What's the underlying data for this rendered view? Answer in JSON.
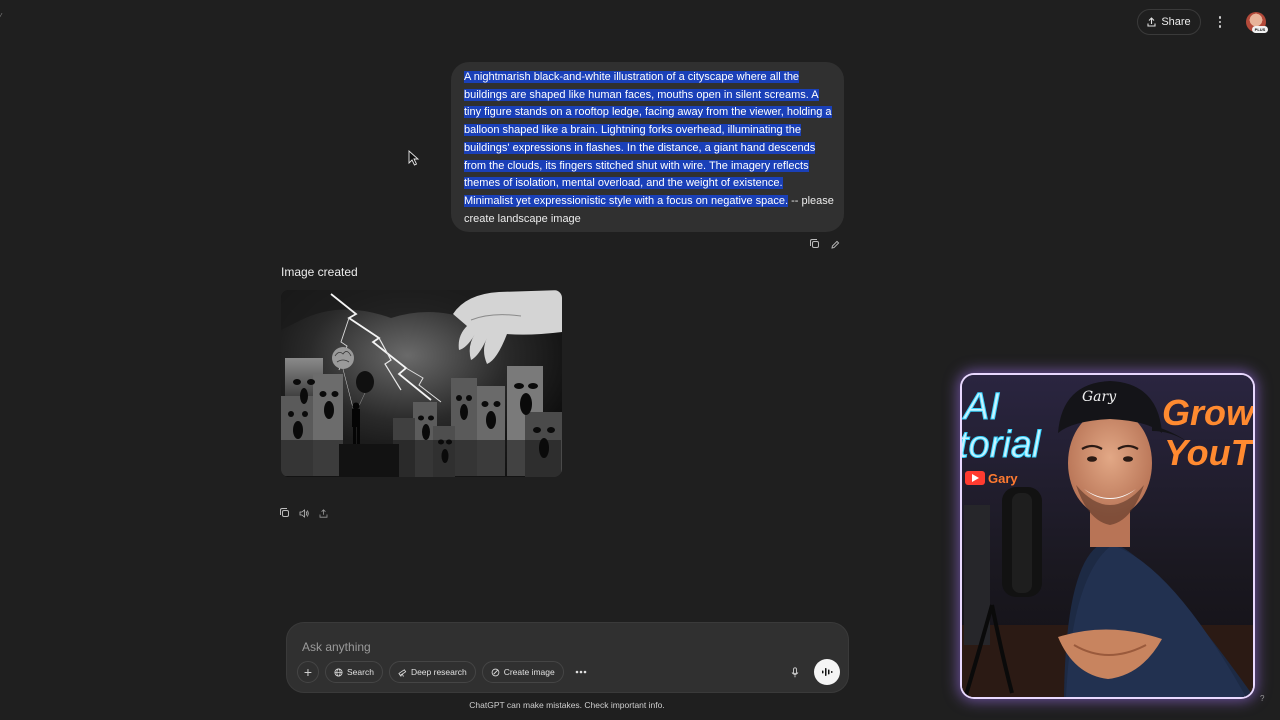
{
  "topbar": {
    "share_label": "Share",
    "avatar_badge": "PLUS"
  },
  "user_message": {
    "selected_text": "A nightmarish black-and-white illustration of a cityscape where all the buildings are shaped like human faces, mouths open in silent screams. A tiny figure stands on a rooftop ledge, facing away from the viewer, holding a balloon shaped like a brain. Lightning forks overhead, illuminating the buildings' expressions in flashes. In the distance, a giant hand descends from the clouds, its fingers stitched shut with wire. The imagery reflects themes of isolation, mental overload, and the weight of existence. Minimalist yet expressionistic style with a focus on negative space.",
    "unselected_text": " -- please create landscape image"
  },
  "assistant": {
    "label": "Image created"
  },
  "composer": {
    "placeholder": "Ask anything",
    "tools": {
      "search": "Search",
      "deep_research": "Deep research",
      "create_image": "Create image"
    }
  },
  "disclaimer": "ChatGPT can make mistakes. Check important info.",
  "webcam": {
    "neon_left_1": "AI",
    "neon_left_2": "torial",
    "neon_right_1": "Grow o",
    "neon_right_2": "YouTub",
    "channel_badge": "Gary",
    "cap_text": "Gary"
  },
  "help": "?"
}
